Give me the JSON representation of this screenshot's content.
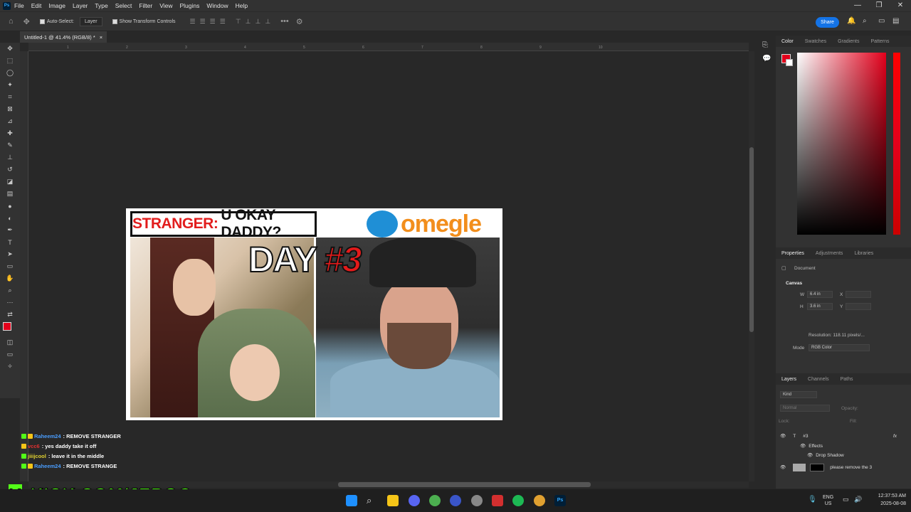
{
  "menubar": {
    "items": [
      "File",
      "Edit",
      "Image",
      "Layer",
      "Type",
      "Select",
      "Filter",
      "View",
      "Plugins",
      "Window",
      "Help"
    ],
    "logo": "Ps"
  },
  "options": {
    "auto_select": "Auto-Select:",
    "layer_dropdown": "Layer",
    "show_transform": "Show Transform Controls",
    "share": "Share"
  },
  "doc_tab": {
    "title": "Untitled-1 @ 41.4% (RGB/8) *",
    "close": "×"
  },
  "ruler": [
    "1",
    "2",
    "3",
    "4",
    "5",
    "6",
    "7",
    "8",
    "9",
    "10"
  ],
  "thumbnail": {
    "banner_label": "STRANGER:",
    "banner_text": "U OKAY DADDY?",
    "logo_word": "omegle",
    "day": "DAY",
    "day_num": "#3"
  },
  "chat": [
    {
      "user": "Raheem24",
      "msg": ": REMOVE STRANGER",
      "color": "#4a9eff"
    },
    {
      "user": "vcc6",
      "msg": ": yes daddy take it off",
      "color": "#e03030"
    },
    {
      "user": "jiiijcool",
      "msg": ": leave it in the middle",
      "color": "#e0d030"
    },
    {
      "user": "Raheem24",
      "msg": ": REMOVE STRANGE",
      "color": "#4a9eff"
    }
  ],
  "kick": {
    "k": "K",
    "url": "KICK.COM/JERQO"
  },
  "panels": {
    "color_tabs": [
      "Color",
      "Swatches",
      "Gradients",
      "Patterns"
    ],
    "prop_tabs": [
      "Properties",
      "Adjustments",
      "Libraries"
    ],
    "document": "Document",
    "canvas": "Canvas",
    "w_label": "W",
    "w_value": "6.4 in",
    "h_label": "H",
    "h_value": "3.6 in",
    "x_label": "X",
    "y_label": "Y",
    "resolution": "Resolution: 118.11 pixels/...",
    "mode_label": "Mode",
    "mode_value": "RGB Color",
    "layer_tabs": [
      "Layers",
      "Channels",
      "Paths"
    ],
    "kind": "Kind",
    "blend": "Normal",
    "opacity": "Opacity:",
    "lock": "Lock:",
    "fill": "Fill:",
    "layers": [
      {
        "name": "#3",
        "fx": "fx"
      },
      {
        "name": "Effects"
      },
      {
        "name": "Drop Shadow"
      },
      {
        "name": "please remove the 3"
      }
    ]
  },
  "taskbar": {
    "lang": "ENG",
    "region": "US",
    "time": "12:37:53 AM",
    "date": "2025-08-08"
  },
  "colors": {
    "accent": "#1473e6",
    "fg": "#e3001b",
    "kick": "#53fc18"
  }
}
